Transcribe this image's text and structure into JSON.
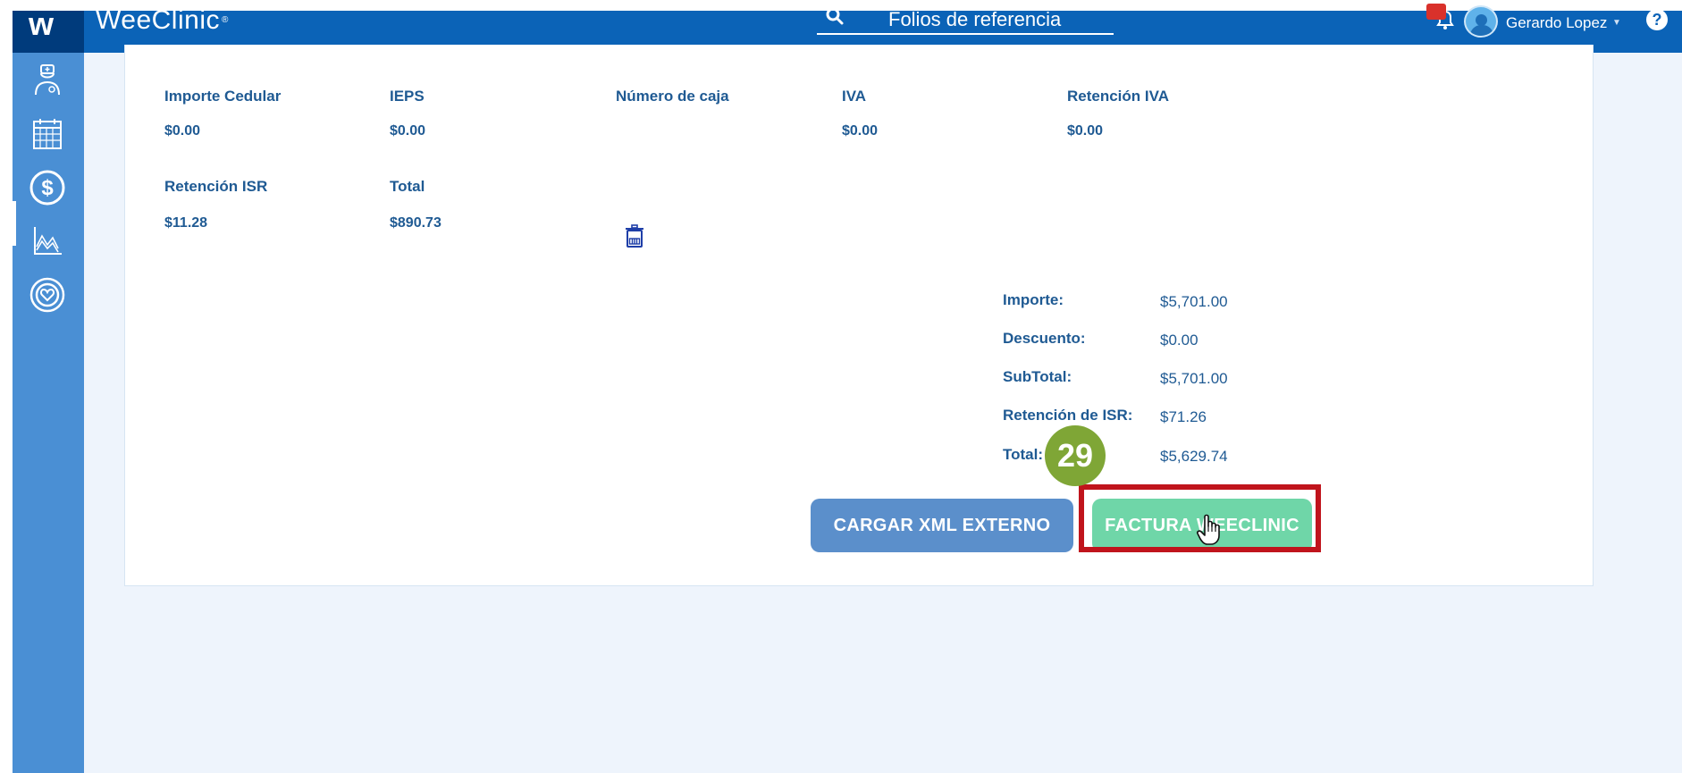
{
  "topbar": {
    "brand": "WeeClinic",
    "brand_sup": "®",
    "search_placeholder": "Folios de referencia",
    "user_name": "Gerardo Lopez",
    "help_symbol": "?"
  },
  "sidebar": {
    "items": [
      {
        "icon": "doctor-icon"
      },
      {
        "icon": "calendar-icon"
      },
      {
        "icon": "billing-dollar-icon",
        "active": true
      },
      {
        "icon": "chart-icon"
      },
      {
        "icon": "heart-target-icon"
      }
    ]
  },
  "details": {
    "row1": [
      {
        "label": "Importe Cedular",
        "value": "$0.00"
      },
      {
        "label": "IEPS",
        "value": "$0.00"
      },
      {
        "label": "Número de caja",
        "value": ""
      },
      {
        "label": "IVA",
        "value": "$0.00"
      },
      {
        "label": "Retención IVA",
        "value": "$0.00"
      }
    ],
    "row2": [
      {
        "label": "Retención ISR",
        "value": "$11.28"
      },
      {
        "label": "Total",
        "value": "$890.73"
      }
    ]
  },
  "totals": [
    {
      "label": "Importe:",
      "value": "$5,701.00"
    },
    {
      "label": "Descuento:",
      "value": "$0.00"
    },
    {
      "label": "SubTotal:",
      "value": "$5,701.00"
    },
    {
      "label": "Retención de ISR:",
      "value": "$71.26"
    },
    {
      "label": "Total:",
      "value": "$5,629.74"
    }
  ],
  "buttons": {
    "xml": "CARGAR XML EXTERNO",
    "factura": "FACTURA WEECLINIC"
  },
  "step_badge": "29",
  "colors": {
    "primary": "#0b63b7",
    "sidebar": "#4a8fd4",
    "text": "#1f5a93",
    "button_xml": "#5b8fcb",
    "button_factura": "#6fd6a8",
    "highlight": "#c0141c",
    "badge": "#7fa636"
  }
}
